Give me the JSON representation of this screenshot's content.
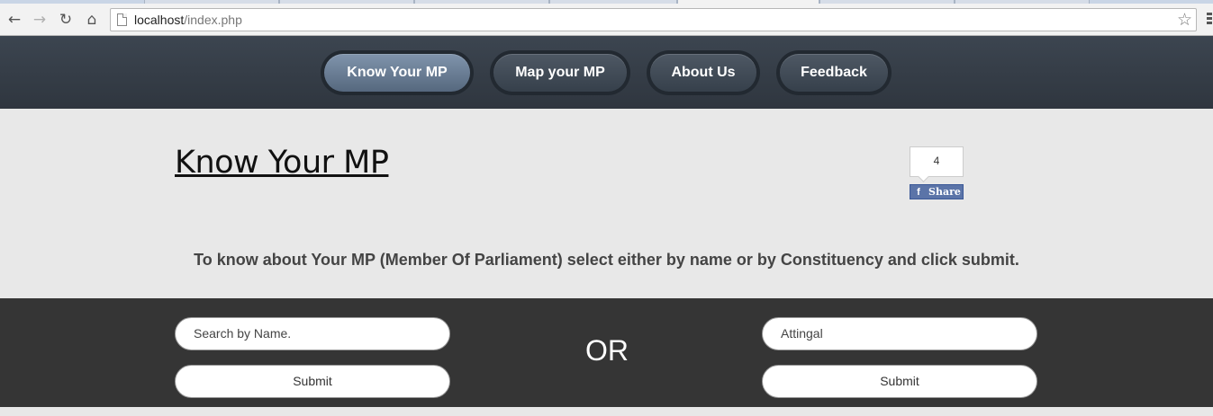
{
  "browser": {
    "url_host": "localhost",
    "url_path": "/index.php",
    "icons": [
      "back-arrow-icon",
      "forward-arrow-icon",
      "reload-icon",
      "home-icon",
      "page-icon",
      "star-icon",
      "menu-icon"
    ]
  },
  "nav": {
    "items": [
      {
        "label": "Know Your MP",
        "active": true
      },
      {
        "label": "Map your MP",
        "active": false
      },
      {
        "label": "About Us",
        "active": false
      },
      {
        "label": "Feedback",
        "active": false
      }
    ]
  },
  "main": {
    "title": "Know Your MP",
    "share_count": "4",
    "share_label": "Share",
    "instruction": "To know about Your MP (Member Of Parliament) select either by name or by Constituency and click submit."
  },
  "search": {
    "name_placeholder": "Search by Name.",
    "name_submit": "Submit",
    "or_label": "OR",
    "constituency_value": "Attingal",
    "constituency_submit": "Submit"
  },
  "colors": {
    "header_bg": "#2f363f",
    "active_nav": "#6b7f96",
    "search_band": "#353535",
    "facebook": "#3b5998"
  }
}
